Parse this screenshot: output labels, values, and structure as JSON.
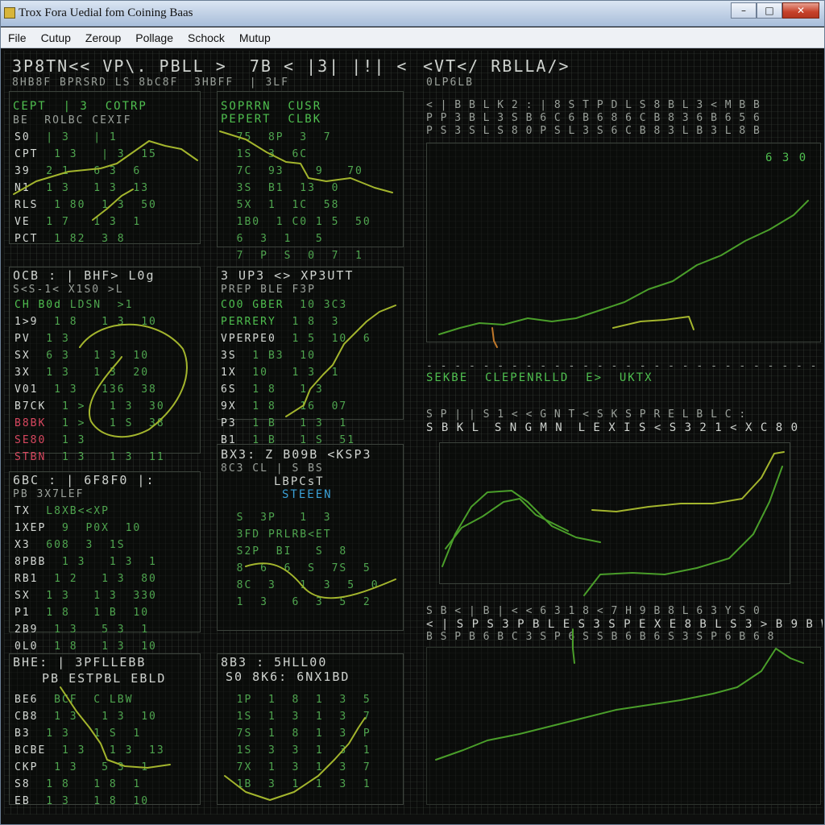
{
  "window": {
    "title": "Trox Fora Uedial fom Coining Baas",
    "buttons": [
      "–",
      "□",
      "✕"
    ]
  },
  "menu": [
    "File",
    "Cutup",
    "Zeroup",
    "Pollage",
    "Schock",
    "Mutup"
  ],
  "header": {
    "left_line1": "3P8TN<< VP\\. PBLL >  7B < |3| |!| <",
    "left_line2": "8HB8F BPRSRD LS 8bC8F  3HBFF  | 3LF",
    "right_line1": "<VT</ RBLLA/>",
    "right_line2": "0LP6LB"
  },
  "panels": {
    "p1": {
      "header": [
        "CEPT  | 3  COTRP",
        "BE  ROLBC CEXIF"
      ],
      "rows": [
        {
          "label": "S0",
          "values": "  | 3   | 1"
        },
        {
          "label": "CPT",
          "values": "  1 3   | 3  15"
        },
        {
          "label": "39",
          "values": "  2 1   6 3  6"
        },
        {
          "label": "N1",
          "values": "  1 3   1 3  13"
        },
        {
          "label": "RLS",
          "values": "  1 80  1 3  50"
        },
        {
          "label": "VE",
          "values": "  1 7   1 3  1"
        },
        {
          "label": "PCT",
          "values": "  1 82  3 8"
        }
      ]
    },
    "p2": {
      "header": [
        "SOPRRN  CUSR",
        "PEPERT  CLBK"
      ],
      "rows": [
        {
          "label": "",
          "values": "  75  8P  3  7"
        },
        {
          "label": "",
          "values": "  1S  3  6C"
        },
        {
          "label": "",
          "values": "  7C  93    9   70"
        },
        {
          "label": "",
          "values": "  3S  B1  13  0"
        },
        {
          "label": "",
          "values": "  5X  1  1C  58"
        },
        {
          "label": "",
          "values": "  1B0  1 C0 1 5  50"
        },
        {
          "label": "",
          "values": "  6  3  1   5"
        },
        {
          "label": "",
          "values": "  7  P  S  0  7  1"
        }
      ]
    },
    "p3": {
      "header": [
        "OCB : | BHF> L0g",
        "S<S-1< X1S0 >L"
      ],
      "rows": [
        {
          "label": "CH B0d",
          "values": " LDSN  >1",
          "tone": "green"
        },
        {
          "label": "1>9",
          "values": "  1 8   1 3  10"
        },
        {
          "label": "PV",
          "values": "  1 3"
        },
        {
          "label": "SX",
          "values": "  6 3   1 3  10"
        },
        {
          "label": "3X",
          "values": "  1 3   1 3  20"
        },
        {
          "label": "V01",
          "values": "  1 3   136  38"
        },
        {
          "label": "B7CK",
          "values": "  1 >   1 3  30"
        },
        {
          "label": "B8BK",
          "values": "  1 >   1 S  38",
          "tone": "red"
        },
        {
          "label": "SE80",
          "values": "  1 3",
          "tone": "red"
        },
        {
          "label": "STBN",
          "values": "  1 3   1 3  11",
          "tone": "red"
        }
      ]
    },
    "p4": {
      "header": [
        "3 UP3 <> XP3UTT",
        "PREP BLE F3P"
      ],
      "rows": [
        {
          "label": "CO0 GBER",
          "values": "  10 3C3",
          "tone": "green"
        },
        {
          "label": "PERRERY",
          "values": "  1 8  3",
          "tone": "green"
        },
        {
          "label": "VPERPE0",
          "values": "  1 5  10  6"
        },
        {
          "label": "3S",
          "values": "  1 B3  10"
        },
        {
          "label": "1X",
          "values": "  10   1 3  1"
        },
        {
          "label": "6S",
          "values": "  1 8   1 3"
        },
        {
          "label": "9X",
          "values": "  1 8   16  07"
        },
        {
          "label": "P3",
          "values": "  1 B   1 3  1"
        },
        {
          "label": "B1",
          "values": "  1 B   1 S  51"
        }
      ]
    },
    "p5": {
      "header": [
        "6BC : | 6F8F0 |:",
        "PB 3X7LEF"
      ],
      "rows": [
        {
          "label": "TX",
          "values": "  L8XB<<XP"
        },
        {
          "label": "1XEP",
          "values": "  9  P0X  10"
        },
        {
          "label": "X3",
          "values": "  608  3  1S"
        },
        {
          "label": "8PBB",
          "values": "  1 3   1 3  1"
        },
        {
          "label": "RB1",
          "values": "  1 2   1 3  80"
        },
        {
          "label": "SX",
          "values": "  1 3   1 3  330"
        },
        {
          "label": "P1",
          "values": "  1 8   1 B  10"
        },
        {
          "label": "2B9",
          "values": "  1 3   5 3  1"
        },
        {
          "label": "0L0",
          "values": "  1 8   1 3  10"
        }
      ]
    },
    "p6": {
      "header": [
        "BX3: Z B09B <KSP3",
        "8C3 CL | S BS"
      ],
      "highlight": "LBPCsT",
      "highlight2": "STEEEN",
      "rows": [
        {
          "label": "",
          "values": "  S  3P   1  3"
        },
        {
          "label": "",
          "values": "  3FD PRLRB<ET"
        },
        {
          "label": "",
          "values": "  S2P  BI   S  8"
        },
        {
          "label": "",
          "values": "  8  6  6  S  7S  5"
        },
        {
          "label": "",
          "values": "  8C  3   1  3  5  0"
        },
        {
          "label": "",
          "values": "  1  3   6  3  5  2"
        }
      ]
    },
    "p7": {
      "header": [
        "BHE: | 3PFLLEBB",
        "PB ESTPBL EBLD"
      ],
      "rows": [
        {
          "label": "BE6",
          "values": "  BCF  C LBW"
        },
        {
          "label": "CB8",
          "values": "  1 3   1 3  10"
        },
        {
          "label": "B3",
          "values": "  1 3   1 S  1"
        },
        {
          "label": "BCBE",
          "values": "  1 3   1 3  13"
        },
        {
          "label": "CKP",
          "values": "  1 3   5 3  1"
        },
        {
          "label": "S8",
          "values": "  1 8   1 8  1"
        },
        {
          "label": "EB",
          "values": "  1 3   1 8  10"
        }
      ]
    },
    "p8": {
      "header": [
        "8B3 : 5HLL00",
        "S0 8K6: 6NX1BD"
      ],
      "rows": [
        {
          "label": "",
          "values": "  1P  1  8  1  3  5"
        },
        {
          "label": "",
          "values": "  1S  1  3  1  3  7"
        },
        {
          "label": "",
          "values": "  7S  1  8  1  3  P"
        },
        {
          "label": "",
          "values": "  1S  3  3  1  3  1"
        },
        {
          "label": "",
          "values": "  7X  1  3  1  3  7"
        },
        {
          "label": "",
          "values": "  1B  3  1  1  3  1"
        }
      ]
    }
  },
  "right": {
    "chart1_header": [
      "< | B B L K 2 : | 8 S T P D L S 8 B L 3 < M B B",
      "P P 3 B L 3 S B 6 C 6 B 6 8 6 C B 8 3 6 B 6 5 6",
      "P S 3 S L S 8 0 P S L 3 S 6 C B 8 3 L B 3 L 8 B"
    ],
    "chart1_label": "6 3 0",
    "mid_banner": "SEKBE  CLEPENRLLD  E>  UKTX",
    "chart2_header": [
      "S P | | S 1 < < G N T < S K S P R E L B L C :",
      "S B K L  S N G M N  L E X I S < S 3 2 1 < X C 8 0"
    ],
    "chart3_header": [
      "S B < | B | < < 6 3 1 8 < 7 H 9 B 8 L 6 3 Y S 0",
      "< | S P S 3 P B L E S 3 S P E X E 8 B L S 3 > B 9 B W",
      "B S P B 6 B C 3 S P 6 S S B 6 B 6 S 3 S P 6 B 6 8"
    ]
  },
  "colors": {
    "trace": "#a3b52d",
    "trace_green": "#4a9e2a",
    "text": "#cfd3cf",
    "value": "#4fa54f",
    "alert": "#d84860",
    "info": "#3aa0d6"
  }
}
